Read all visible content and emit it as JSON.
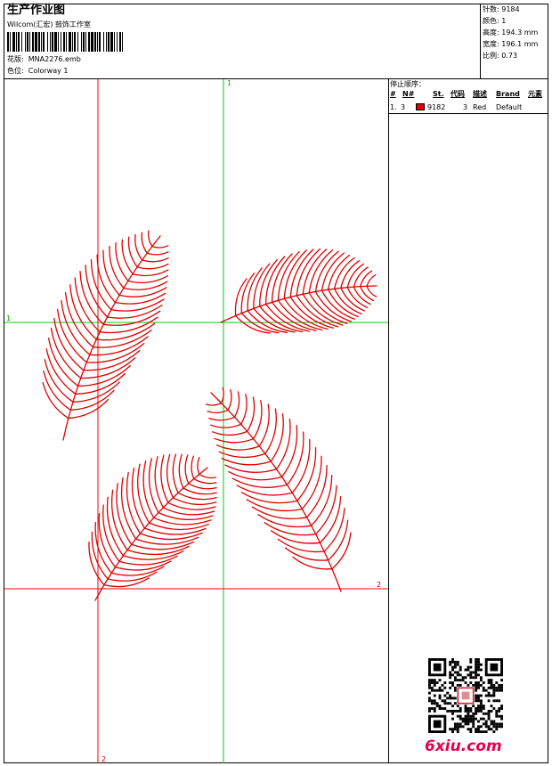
{
  "header": {
    "title": "生产作业图",
    "company": "Wilcom(汇宏) 鼓饰工作室",
    "design": "花版:  MNA2276.emb",
    "colorway": "色位:  Colorway 1"
  },
  "stats": [
    {
      "label": "针数",
      "value": "9184"
    },
    {
      "label": "颜色",
      "value": "1"
    },
    {
      "label": "高度",
      "value": "194.3 mm"
    },
    {
      "label": "宽度",
      "value": "196.1 mm"
    },
    {
      "label": "比例",
      "value": "0.73"
    }
  ],
  "stop_sequence": {
    "header": "停止顺序：",
    "columns": [
      "#",
      "N#",
      "St.",
      "代码",
      "描述",
      "Brand",
      "元素"
    ],
    "rows": [
      {
        "index": "1.",
        "needle": "3",
        "swatch_color": "#e00000",
        "stitches": "9182",
        "code": "3",
        "description": "Red",
        "brand": "Default",
        "element": ""
      }
    ]
  },
  "axis_labels": {
    "v_green": "1",
    "h_green": "1",
    "h_red": "2",
    "v_red": "2"
  },
  "colors": {
    "thread": "#e00000",
    "green_guide": "#00cc00",
    "red_guide": "#ff0000",
    "watermark": "#e8004a"
  },
  "watermark": "6xiu.com"
}
